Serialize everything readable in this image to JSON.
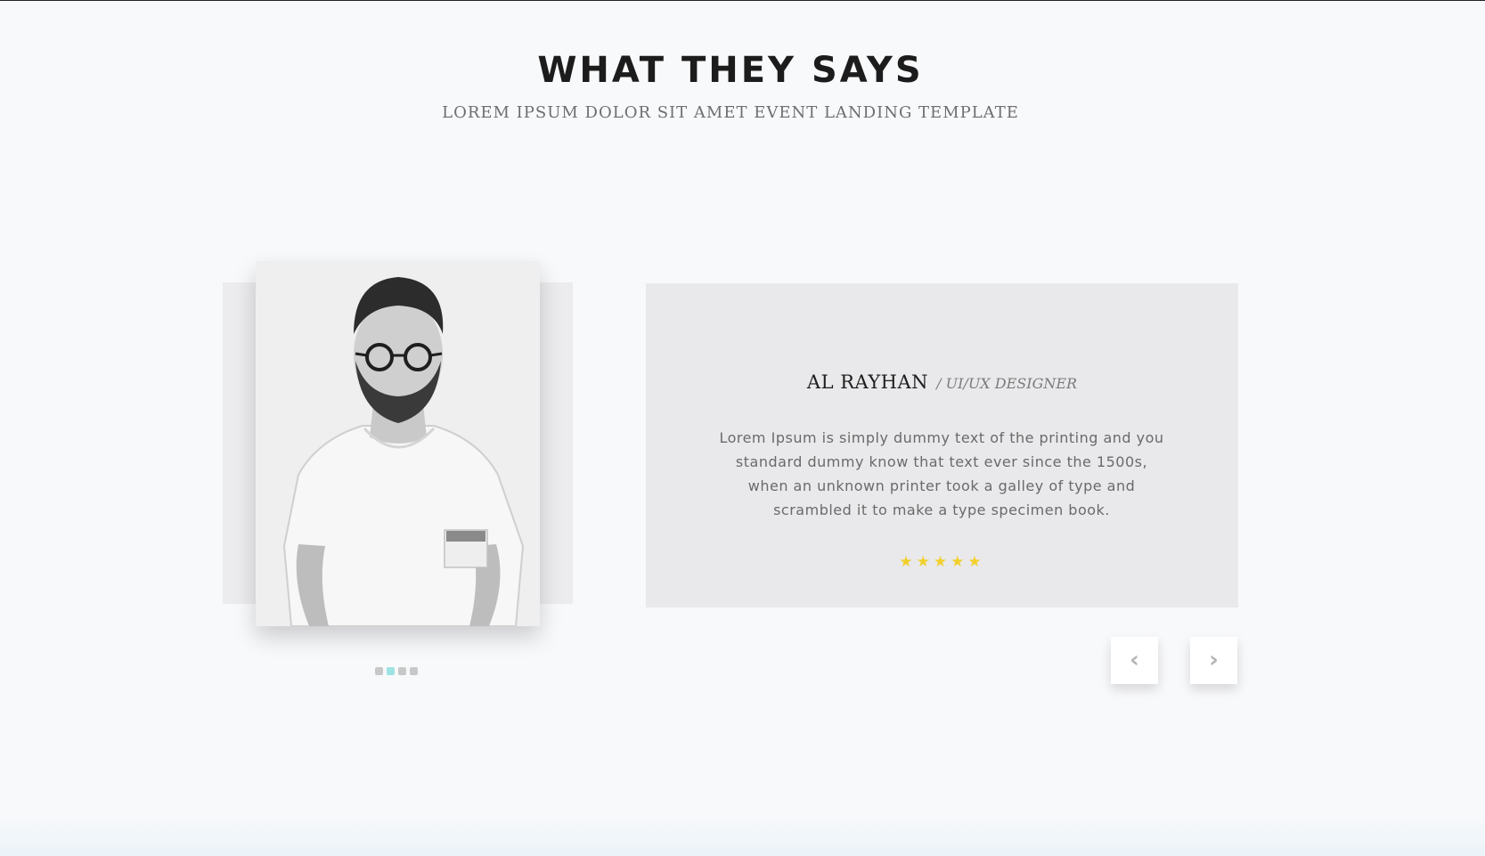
{
  "section": {
    "title": "WHAT THEY SAYS",
    "subtitle": "LOREM IPSUM DOLOR SIT AMET EVENT LANDING TEMPLATE"
  },
  "testimonial": {
    "name": "AL RAYHAN",
    "role": "/ UI/UX DESIGNER",
    "quote": "Lorem Ipsum is simply dummy text of the printing and you standard dummy know that text ever since the 1500s, when an unknown printer took a galley of type and scrambled it to make a type specimen book.",
    "rating": 5,
    "stars": "★★★★★",
    "star_color": "#f1d02c"
  },
  "carousel": {
    "dot_count": 4,
    "active_dot": 1,
    "prev_glyph": "‹",
    "next_glyph": "›",
    "active_dot_color": "#9ee3e3"
  }
}
